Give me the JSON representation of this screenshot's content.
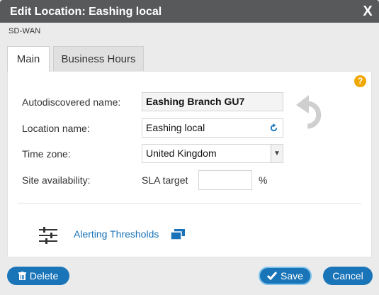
{
  "dialog": {
    "title": "Edit Location: Eashing local",
    "close_label": "X",
    "subtitle": "SD-WAN"
  },
  "tabs": [
    {
      "label": "Main",
      "active": true
    },
    {
      "label": "Business Hours",
      "active": false
    }
  ],
  "form": {
    "autodiscovered_label": "Autodiscovered name:",
    "autodiscovered_value": "Eashing Branch GU7",
    "location_label": "Location name:",
    "location_value": "Eashing local",
    "timezone_label": "Time zone:",
    "timezone_value": "United Kingdom",
    "site_label": "Site availability:",
    "sla_label": "SLA target",
    "sla_value": "",
    "sla_unit": "%"
  },
  "help_icon": "?",
  "alerting": {
    "link_label": "Alerting Thresholds"
  },
  "footer": {
    "delete_label": "Delete",
    "save_label": "Save",
    "cancel_label": "Cancel"
  },
  "colors": {
    "accent": "#1a74b8",
    "titlebar": "#58595b",
    "help": "#f0a800"
  },
  "icons": {
    "close": "close-icon",
    "help": "help-icon",
    "refresh": "refresh-icon",
    "undo": "undo-icon",
    "thresholds": "sliders-icon",
    "open_window": "open-window-icon",
    "trash": "trash-icon",
    "check": "check-icon"
  }
}
